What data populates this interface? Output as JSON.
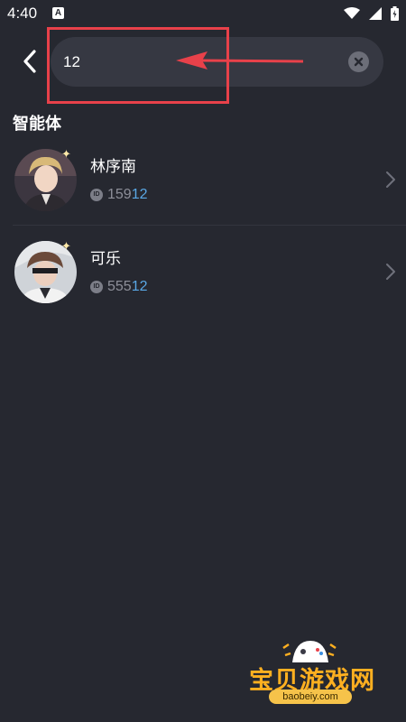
{
  "status_bar": {
    "time": "4:40",
    "notification_icon": "a-letter-icon",
    "icons": [
      "wifi-icon",
      "signal-icon",
      "battery-icon"
    ]
  },
  "search": {
    "value": "12",
    "clear_icon": "close-circle-icon",
    "back_icon": "chevron-left-icon"
  },
  "section": {
    "title": "智能体"
  },
  "results": [
    {
      "name": "林序南",
      "id_prefix": "159",
      "id_match": "12",
      "id_badge": "ID"
    },
    {
      "name": "可乐",
      "id_prefix": "555",
      "id_match": "12",
      "id_badge": "ID"
    }
  ],
  "annotation": {
    "highlight_color": "#e8414a"
  },
  "watermark": {
    "text": "宝贝游戏网",
    "url": "baobeiy.com"
  },
  "colors": {
    "background": "#262830",
    "search_bg": "#363842",
    "match_highlight": "#5aa8e6",
    "muted_text": "#8d8f99"
  }
}
